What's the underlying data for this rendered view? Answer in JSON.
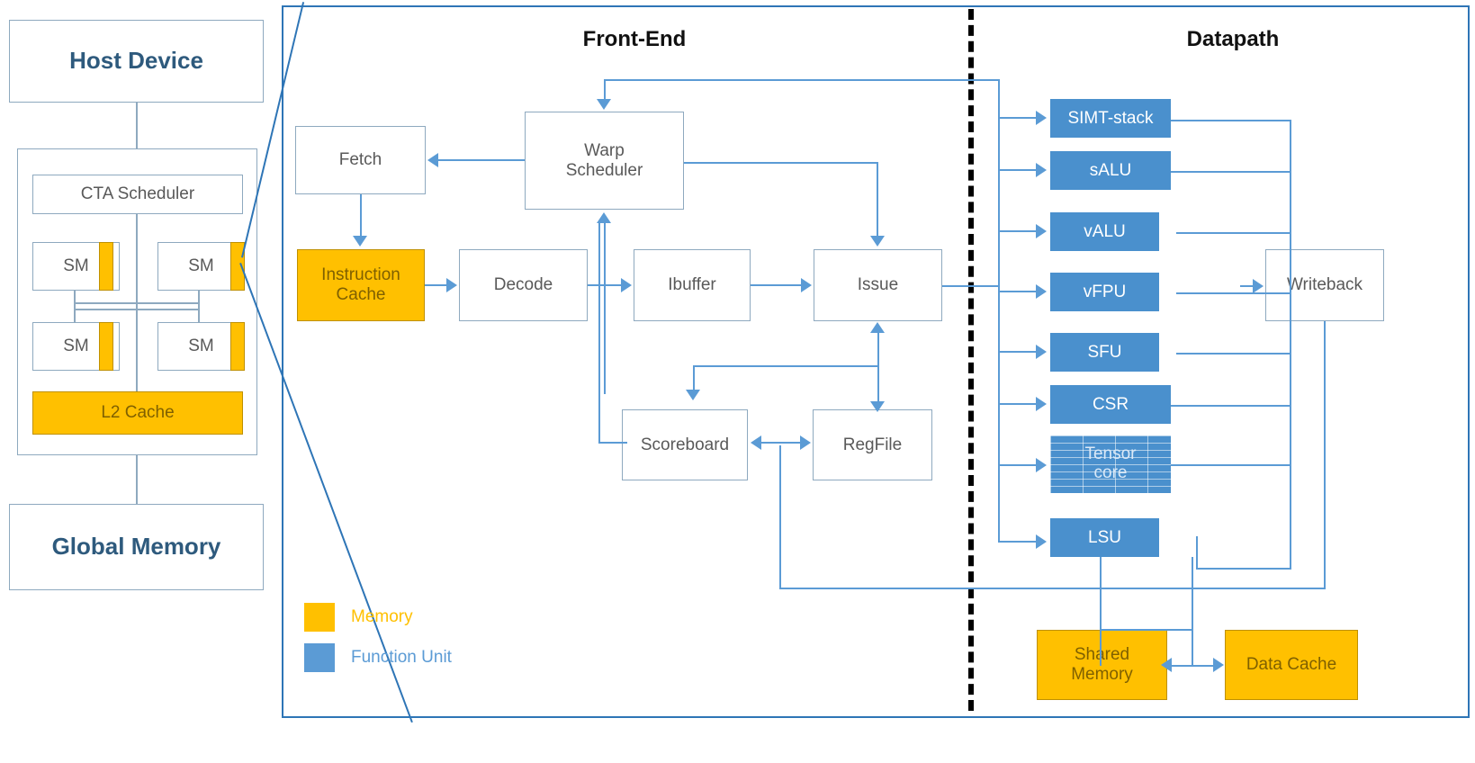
{
  "left_panel": {
    "host": "Host Device",
    "global_memory": "Global Memory",
    "cta_scheduler": "CTA Scheduler",
    "sm_label": "SM",
    "sms": [
      "SM",
      "SM",
      "SM",
      "SM"
    ],
    "l2_cache": "L2 Cache"
  },
  "sections": {
    "front_end": "Front-End",
    "datapath": "Datapath"
  },
  "front_end_blocks": {
    "fetch": "Fetch",
    "warp_scheduler": "Warp\nScheduler",
    "warp_scheduler_line1": "Warp",
    "warp_scheduler_line2": "Scheduler",
    "instruction_cache_line1": "Instruction",
    "instruction_cache_line2": "Cache",
    "decode": "Decode",
    "ibuffer": "Ibuffer",
    "issue": "Issue",
    "scoreboard": "Scoreboard",
    "regfile": "RegFile"
  },
  "datapath_blocks": {
    "simt_stack": "SIMT-stack",
    "salu": "sALU",
    "valu": "vALU",
    "vfpu": "vFPU",
    "sfu": "SFU",
    "csr": "CSR",
    "tensor_core_line1": "Tensor",
    "tensor_core_line2": "core",
    "lsu": "LSU",
    "writeback": "Writeback",
    "shared_memory_line1": "Shared",
    "shared_memory_line2": "Memory",
    "data_cache": "Data Cache"
  },
  "legend": {
    "items": [
      {
        "label": "Memory",
        "color": "#FFC000"
      },
      {
        "label": "Function Unit",
        "color": "#5B9BD5"
      }
    ]
  },
  "colors": {
    "memory": "#FFC000",
    "function_unit": "#4A90CD",
    "connector": "#5B9BD5",
    "box_border": "#8ea9bf",
    "panel_border": "#2E75B6",
    "header_text": "#2e5a7d"
  }
}
